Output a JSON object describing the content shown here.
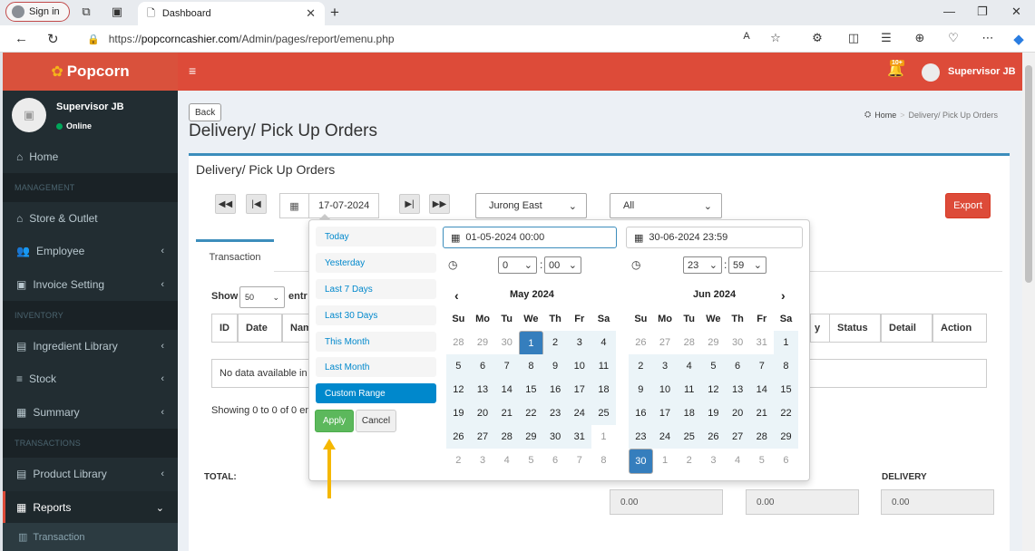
{
  "browser": {
    "sign_in": "Sign in",
    "tab_title": "Dashboard",
    "url_prefix": "https://",
    "url_host": "popcorncashier.com",
    "url_path": "/Admin/pages/report/emenu.php"
  },
  "app": {
    "brand": "Popcorn",
    "notif_badge": "10+",
    "top_user": "Supervisor JB",
    "user_name": "Supervisor JB",
    "user_status": "Online"
  },
  "sidebar": {
    "home": "Home",
    "head_management": "MANAGEMENT",
    "store": "Store & Outlet",
    "employee": "Employee",
    "invoice": "Invoice Setting",
    "head_inventory": "INVENTORY",
    "ingredient": "Ingredient Library",
    "stock": "Stock",
    "summary": "Summary",
    "head_transactions": "TRANSACTIONS",
    "product": "Product Library",
    "reports": "Reports",
    "transaction": "Transaction"
  },
  "page": {
    "back": "Back",
    "title": "Delivery/ Pick Up Orders",
    "crumb_home": "Home",
    "crumb_sep": ">",
    "crumb_current": "Delivery/ Pick Up Orders",
    "box_title": "Delivery/ Pick Up Orders",
    "date": "17-07-2024",
    "outlet": "Jurong East",
    "filter": "All",
    "export": "Export",
    "tab": "Transaction",
    "show": "Show",
    "show_value": "50",
    "entries": "entr",
    "cols": [
      "ID",
      "Date",
      "Nam",
      "Status",
      "Detail",
      "Action"
    ],
    "col_extra": "y",
    "nodata": "No data available in t",
    "showing": "Showing 0 to 0 of 0 en",
    "total": "TOTAL:",
    "delivery": "DELIVERY",
    "sums": [
      "0.00",
      "0.00",
      "0.00"
    ]
  },
  "picker": {
    "ranges": [
      "Today",
      "Yesterday",
      "Last 7 Days",
      "Last 30 Days",
      "This Month",
      "Last Month",
      "Custom Range"
    ],
    "active_range": "Custom Range",
    "apply": "Apply",
    "cancel": "Cancel",
    "start": "01-05-2024 00:00",
    "end": "30-06-2024 23:59",
    "start_hour": "0",
    "start_min": "00",
    "end_hour": "23",
    "end_min": "59",
    "left_month": "May 2024",
    "right_month": "Jun 2024",
    "dow": [
      "Su",
      "Mo",
      "Tu",
      "We",
      "Th",
      "Fr",
      "Sa"
    ],
    "left_days": [
      [
        "28",
        "29",
        "30",
        "1",
        "2",
        "3",
        "4"
      ],
      [
        "5",
        "6",
        "7",
        "8",
        "9",
        "10",
        "11"
      ],
      [
        "12",
        "13",
        "14",
        "15",
        "16",
        "17",
        "18"
      ],
      [
        "19",
        "20",
        "21",
        "22",
        "23",
        "24",
        "25"
      ],
      [
        "26",
        "27",
        "28",
        "29",
        "30",
        "31",
        "1"
      ],
      [
        "2",
        "3",
        "4",
        "5",
        "6",
        "7",
        "8"
      ]
    ],
    "right_days": [
      [
        "26",
        "27",
        "28",
        "29",
        "30",
        "31",
        "1"
      ],
      [
        "2",
        "3",
        "4",
        "5",
        "6",
        "7",
        "8"
      ],
      [
        "9",
        "10",
        "11",
        "12",
        "13",
        "14",
        "15"
      ],
      [
        "16",
        "17",
        "18",
        "19",
        "20",
        "21",
        "22"
      ],
      [
        "23",
        "24",
        "25",
        "26",
        "27",
        "28",
        "29"
      ],
      [
        "30",
        "1",
        "2",
        "3",
        "4",
        "5",
        "6"
      ]
    ]
  }
}
